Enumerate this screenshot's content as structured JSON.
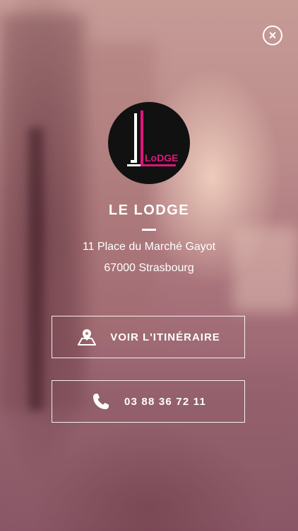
{
  "venue": {
    "name": "LE LODGE",
    "logo_text": "LoDGE",
    "address_line1": "11 Place du Marché Gayot",
    "address_line2": "67000 Strasbourg"
  },
  "actions": {
    "route_label": "VOIR L'ITINÉRAIRE",
    "route_icon": "map-pin-icon",
    "phone_label": "03 88 36 72 11",
    "phone_icon": "phone-icon"
  },
  "controls": {
    "close_icon": "close-icon"
  },
  "colors": {
    "logo_background": "#111111",
    "logo_accent": "#e0157a",
    "text": "#ffffff"
  }
}
